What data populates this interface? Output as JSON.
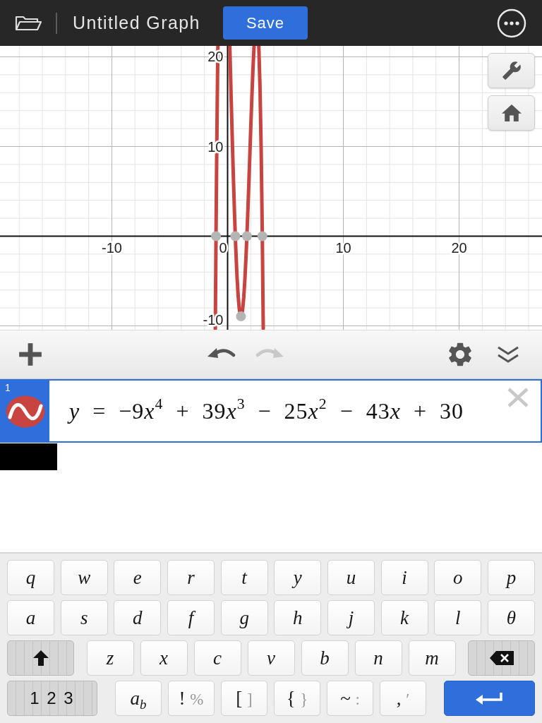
{
  "top_bar": {
    "title": "Untitled Graph",
    "save_button": "Save"
  },
  "graph": {
    "chart_data": {
      "type": "line",
      "grid": true,
      "x": [
        -1.06,
        -1,
        -0.95,
        -0.9,
        -0.87,
        -0.837,
        -0.3,
        0.19,
        0.2,
        0.3,
        0.4,
        0.5,
        0.6,
        0.667,
        0.7,
        0.8,
        0.9,
        1,
        1.1,
        1.157,
        1.2,
        1.3,
        1.4,
        1.5,
        1.6,
        1.667,
        1.7,
        1.8,
        1.9,
        2,
        2.1,
        2.2,
        2.287,
        2.5,
        2.695,
        2.7,
        2.8,
        2.9,
        3,
        3.082
      ],
      "series": [
        {
          "color": "#c74440",
          "values": [
            -10.32,
            0,
            7.52,
            14.11,
            17.65,
            21.19,
            null,
            21.18,
            20.7,
            15.83,
            11.07,
            6.56,
            2.46,
            0,
            -1.13,
            -4.12,
            -6.42,
            -8,
            -8.82,
            -8.94,
            -8.87,
            -8.17,
            -6.76,
            -4.69,
            -2.04,
            0,
            1.09,
            4.57,
            8.26,
            12,
            15.6,
            18.84,
            21.2,
            null,
            21.16,
            20.99,
            16.54,
            9.67,
            0,
            -10.3
          ]
        }
      ],
      "xlim": [
        -19.66,
        27.16
      ],
      "ylim": [
        -10.43,
        21.22
      ],
      "xticks": [
        -10,
        0,
        10,
        20
      ],
      "yticks": [
        -10,
        10,
        20
      ]
    }
  },
  "toolbar": {
    "undo": {
      "disabled": false
    },
    "redo": {
      "disabled": true
    }
  },
  "expressions": [
    {
      "number": "1",
      "selected": true,
      "color": "#c74440",
      "formula": [
        {
          "kind": "var",
          "text": "y"
        },
        {
          "kind": "text",
          "text": " = −9"
        },
        {
          "kind": "var",
          "text": "x"
        },
        {
          "kind": "sup",
          "text": "4"
        },
        {
          "kind": "text",
          "text": " + 39"
        },
        {
          "kind": "var",
          "text": "x"
        },
        {
          "kind": "sup",
          "text": "3"
        },
        {
          "kind": "text",
          "text": " − 25"
        },
        {
          "kind": "var",
          "text": "x"
        },
        {
          "kind": "sup",
          "text": "2"
        },
        {
          "kind": "text",
          "text": " − 43"
        },
        {
          "kind": "var",
          "text": "x"
        },
        {
          "kind": "text",
          "text": " + 30"
        }
      ]
    }
  ],
  "keyboard": {
    "rows": [
      {
        "keys": [
          {
            "kind": "letter",
            "label": "q"
          },
          {
            "kind": "letter",
            "label": "w"
          },
          {
            "kind": "letter",
            "label": "e"
          },
          {
            "kind": "letter",
            "label": "r"
          },
          {
            "kind": "letter",
            "label": "t"
          },
          {
            "kind": "letter",
            "label": "y"
          },
          {
            "kind": "letter",
            "label": "u"
          },
          {
            "kind": "letter",
            "label": "i"
          },
          {
            "kind": "letter",
            "label": "o"
          },
          {
            "kind": "letter",
            "label": "p"
          }
        ]
      },
      {
        "keys": [
          {
            "kind": "letter",
            "label": "a"
          },
          {
            "kind": "letter",
            "label": "s"
          },
          {
            "kind": "letter",
            "label": "d"
          },
          {
            "kind": "letter",
            "label": "f"
          },
          {
            "kind": "letter",
            "label": "g"
          },
          {
            "kind": "letter",
            "label": "h"
          },
          {
            "kind": "letter",
            "label": "j"
          },
          {
            "kind": "letter",
            "label": "k"
          },
          {
            "kind": "letter",
            "label": "l"
          },
          {
            "kind": "letter",
            "label": "θ"
          }
        ]
      },
      {
        "keys": [
          {
            "kind": "shift"
          },
          {
            "kind": "letter",
            "label": "z"
          },
          {
            "kind": "letter",
            "label": "x"
          },
          {
            "kind": "letter",
            "label": "c"
          },
          {
            "kind": "letter",
            "label": "v"
          },
          {
            "kind": "letter",
            "label": "b"
          },
          {
            "kind": "letter",
            "label": "n"
          },
          {
            "kind": "letter",
            "label": "m"
          },
          {
            "kind": "backspace"
          }
        ]
      },
      {
        "keys": [
          {
            "kind": "mode",
            "label": "1 2 3"
          },
          {
            "kind": "subscript",
            "label": "a$_{b}$"
          },
          {
            "kind": "pair",
            "label": "!",
            "secondary": "%"
          },
          {
            "kind": "pair",
            "label": "[",
            "secondary": "]"
          },
          {
            "kind": "pair",
            "label": "{",
            "secondary": "}"
          },
          {
            "kind": "pair",
            "label": "~",
            "secondary": ":"
          },
          {
            "kind": "pair",
            "label": ",",
            "secondary": "′"
          },
          {
            "kind": "enter"
          }
        ]
      }
    ]
  }
}
